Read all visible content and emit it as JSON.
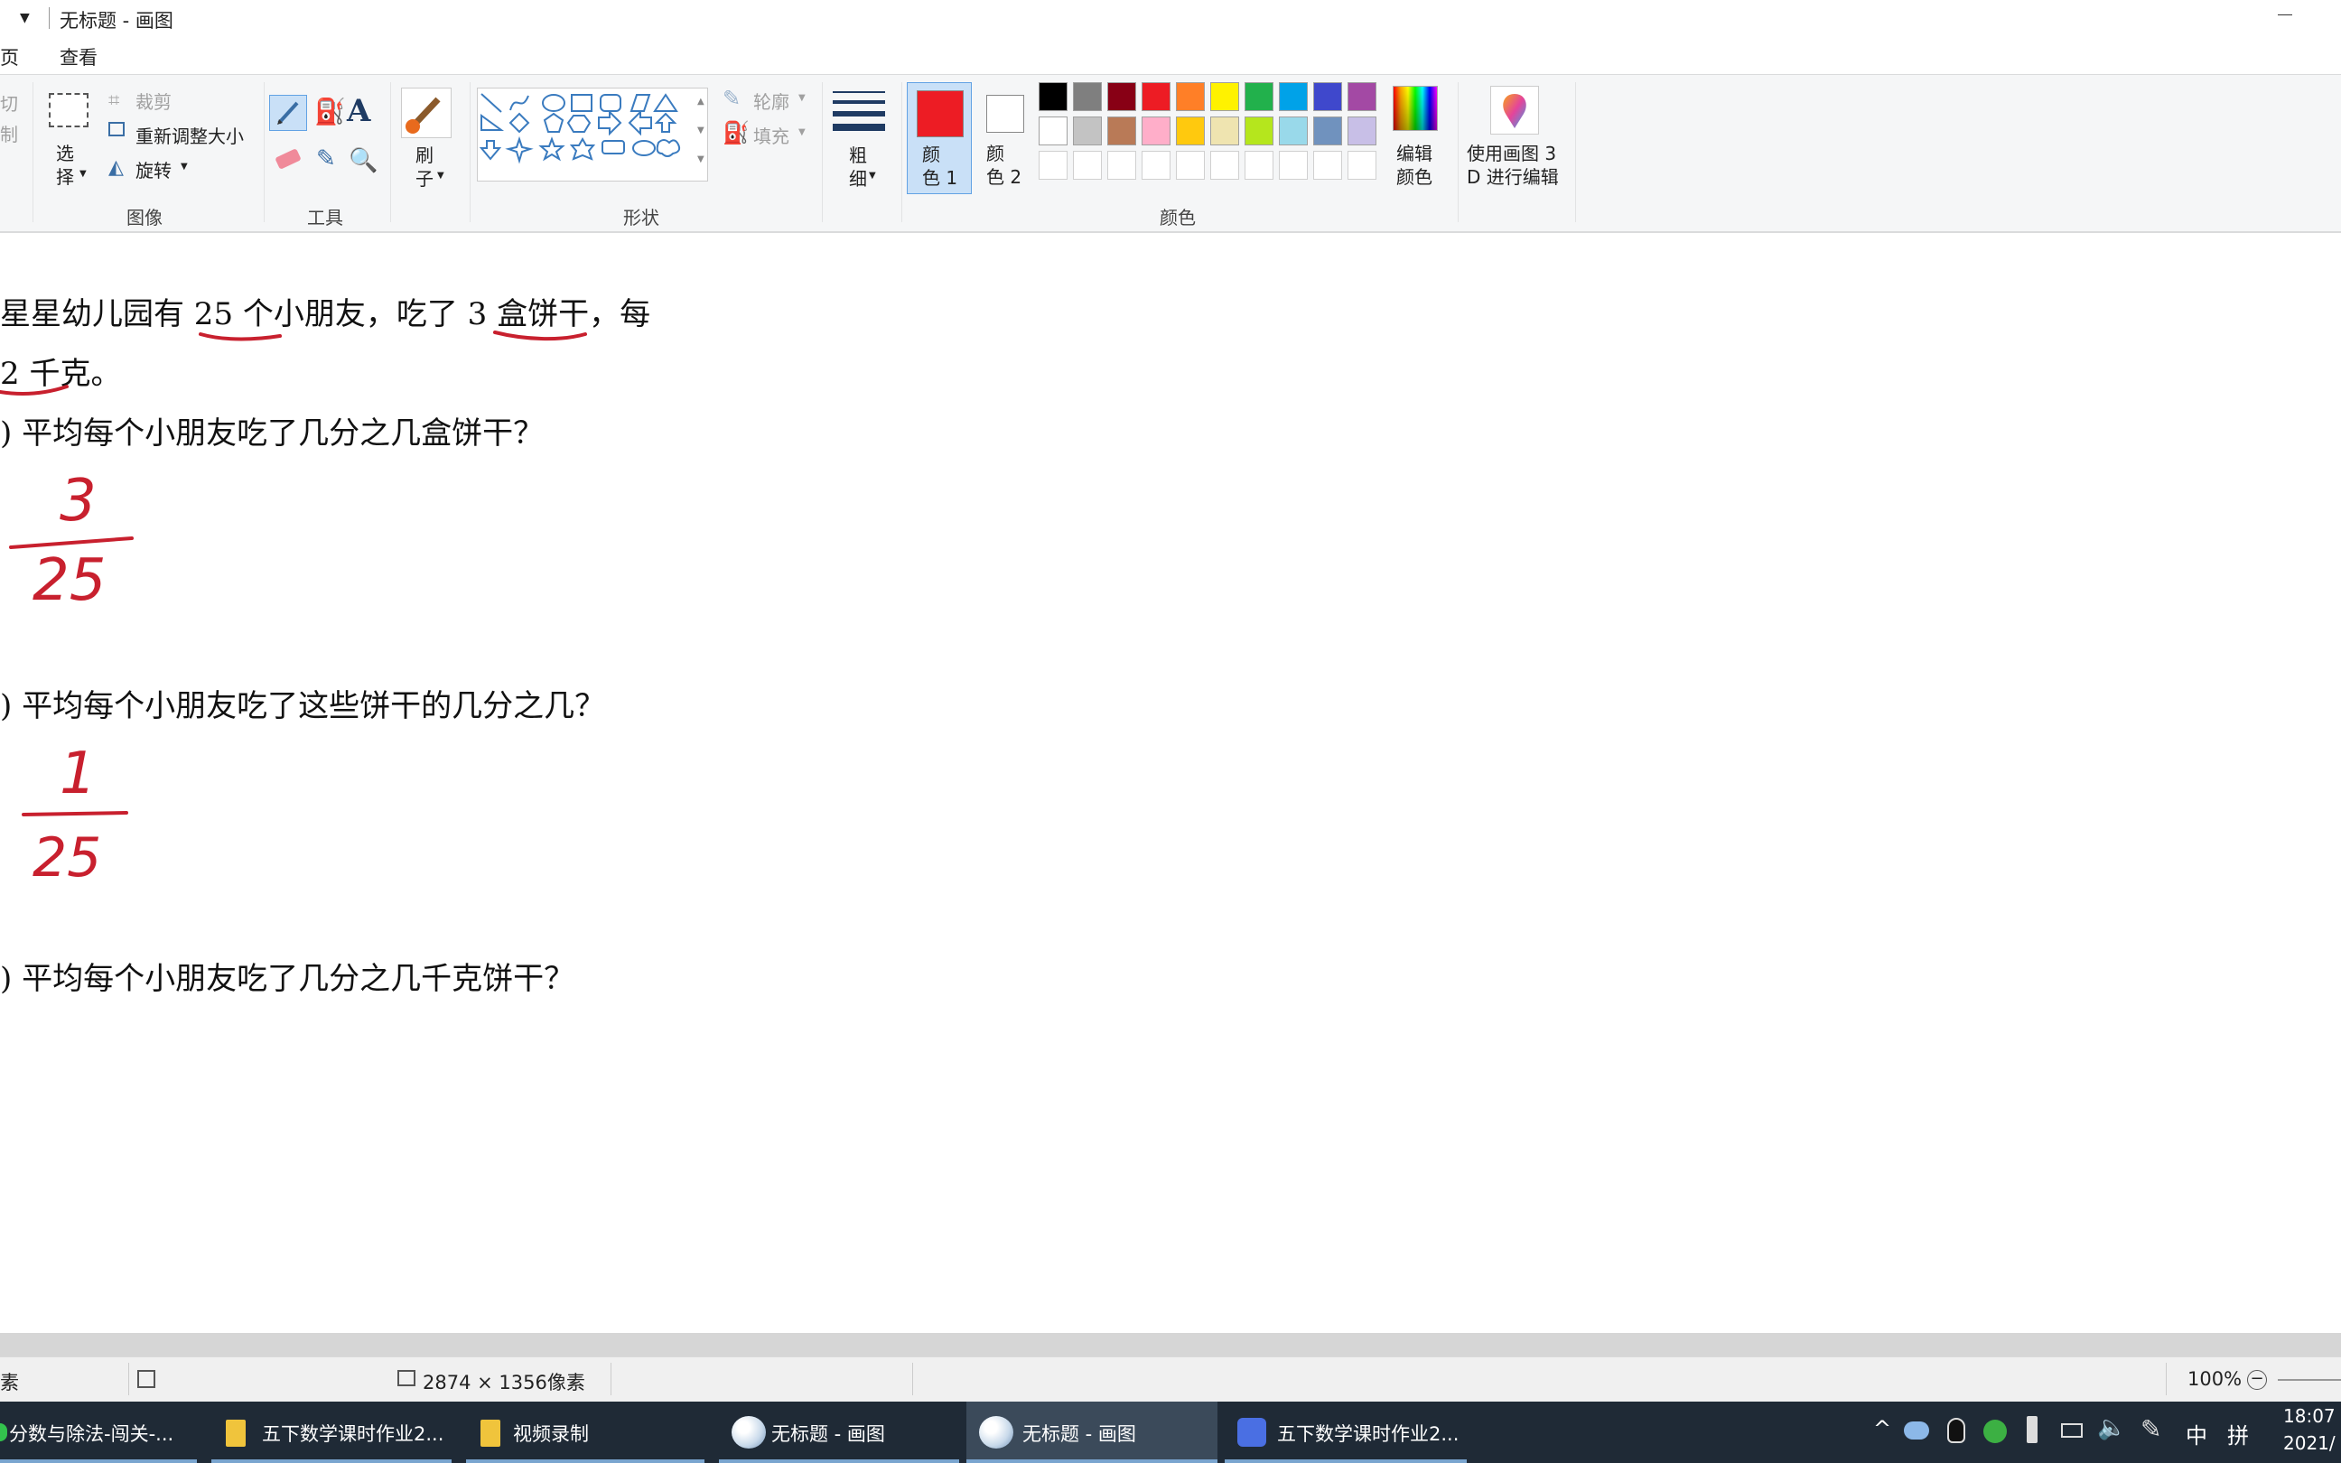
{
  "window": {
    "title": "无标题 - 画图"
  },
  "tabs": [
    "页",
    "查看"
  ],
  "ribbon": {
    "clipboard": {
      "cut": "切",
      "copy": "制"
    },
    "image": {
      "select": "选\n择",
      "crop": "裁剪",
      "resize": "重新调整大小",
      "rotate": "旋转",
      "group": "图像"
    },
    "tools": {
      "group": "工具"
    },
    "brushes": {
      "label": "刷\n子"
    },
    "shapes": {
      "outline": "轮廓",
      "fill": "填充",
      "group": "形状"
    },
    "size": {
      "label": "粗\n细"
    },
    "colors": {
      "color1": "颜\n色 1",
      "color2": "颜\n色 2",
      "edit": "编辑\n颜色",
      "paint3d": "使用画图 3\nD 进行编辑",
      "group": "颜色",
      "color1_value": "#ed1c24",
      "color2_value": "#ffffff",
      "palette_row1": [
        "#000000",
        "#7f7f7f",
        "#880015",
        "#ed1c24",
        "#ff7f27",
        "#fff200",
        "#22b14c",
        "#00a2e8",
        "#3f48cc",
        "#a349a4"
      ],
      "palette_row2": [
        "#ffffff",
        "#c3c3c3",
        "#b97a57",
        "#ffaec9",
        "#ffc90e",
        "#efe4b0",
        "#b5e61d",
        "#99d9ea",
        "#7092be",
        "#c8bfe7"
      ]
    }
  },
  "canvas": {
    "line1": "星星幼儿园有 25 个小朋友，吃了 3 盒饼干，每",
    "line2": "2 千克。",
    "q1": ") 平均每个小朋友吃了几分之几盒饼干？",
    "q2": ") 平均每个小朋友吃了这些饼干的几分之几？",
    "q3": ") 平均每个小朋友吃了几分之几千克饼干？",
    "ans1_num": "3",
    "ans1_den": "25",
    "ans2_num": "1",
    "ans2_den": "25",
    "ink_color": "#c8202e"
  },
  "status": {
    "left": "素",
    "size": "2874 × 1356像素",
    "zoom": "100%"
  },
  "taskbar": {
    "items": [
      "分数与除法-闯关-...",
      "五下数学课时作业2...",
      "视频录制",
      "无标题 - 画图",
      "无标题 - 画图",
      "五下数学课时作业2..."
    ],
    "ime": "中",
    "ime2": "拼",
    "time": "18:07",
    "date": "2021/"
  }
}
